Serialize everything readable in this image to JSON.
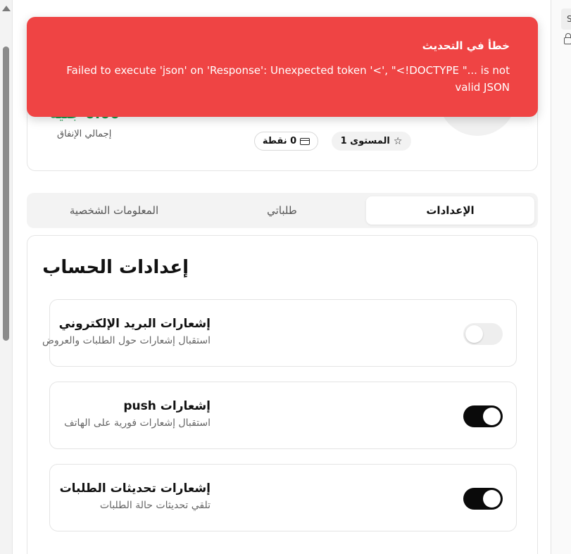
{
  "toast": {
    "title": "خطأ في التحديث",
    "message": "Failed to execute 'json' on 'Response': Unexpected token '<', \"<!DOCTYPE \"... is not valid JSON"
  },
  "profile": {
    "total_amount": "0.00 جنيه",
    "total_label": "إجمالي الإنفاق",
    "level_label": "المستوى 1",
    "points_label": "0 نقطة"
  },
  "tabs": [
    {
      "label": "الإعدادات",
      "active": true
    },
    {
      "label": "طلباتي",
      "active": false
    },
    {
      "label": "المعلومات الشخصية",
      "active": false
    }
  ],
  "settings": {
    "title": "إعدادات الحساب",
    "rows": [
      {
        "title": "إشعارات البريد الإلكتروني",
        "description": "استقبال إشعارات حول الطلبات والعروض",
        "enabled": false
      },
      {
        "title": "إشعارات push",
        "description": "استقبال إشعارات فورية على الهاتف",
        "enabled": true
      },
      {
        "title": "إشعارات تحديثات الطلبات",
        "description": "تلقي تحديثات حالة الطلبات",
        "enabled": true
      }
    ]
  },
  "right_panel": {
    "chip_text": "S"
  },
  "colors": {
    "toast": "#ef4444",
    "amount": "#1a9a4c",
    "toggle_on": "#0a0a0a",
    "toggle_off": "#eeeeee"
  }
}
